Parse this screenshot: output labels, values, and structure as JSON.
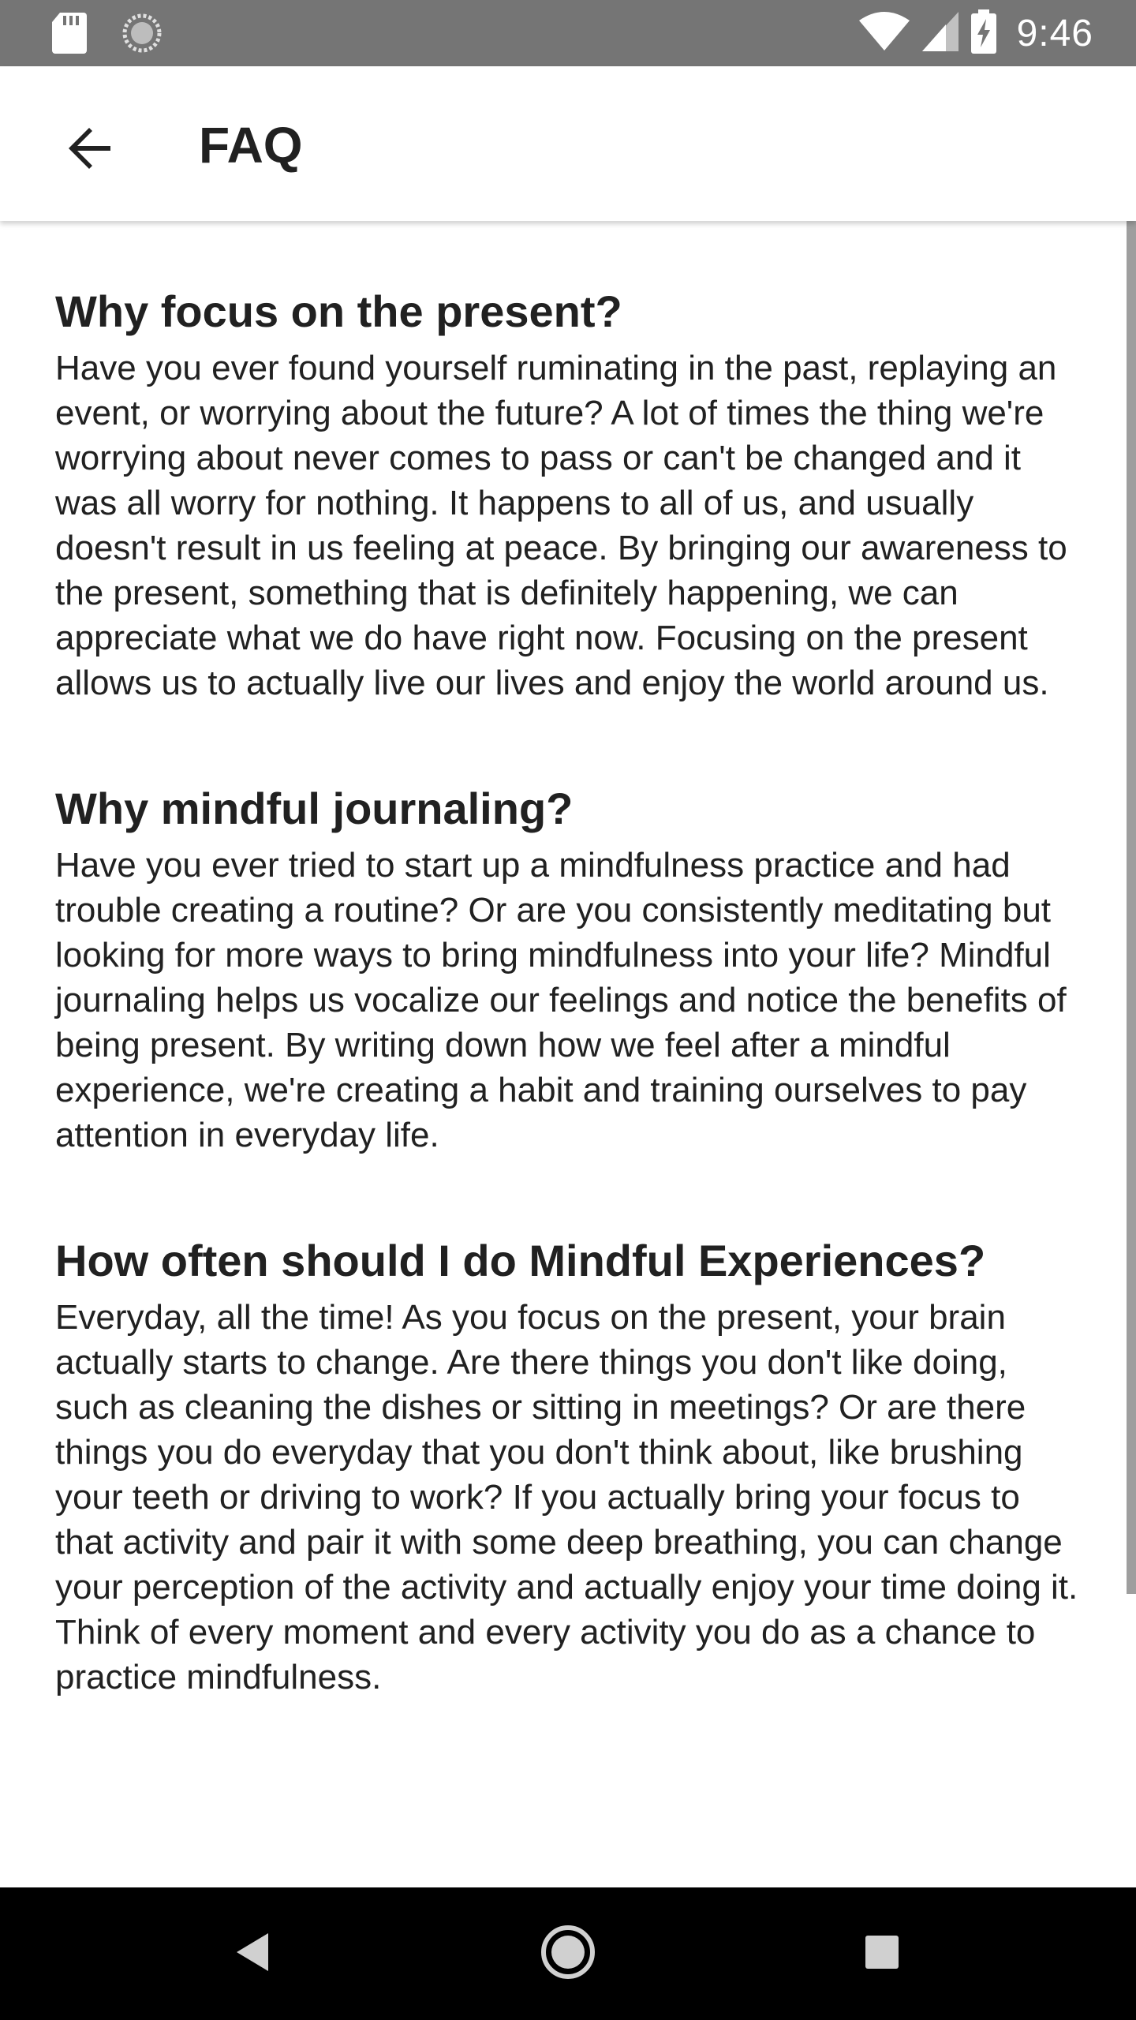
{
  "status_bar": {
    "time": "9:46",
    "icons": [
      "sd-card-icon",
      "sync-icon",
      "wifi-icon",
      "signal-icon",
      "battery-charging-icon"
    ]
  },
  "app_bar": {
    "title": "FAQ",
    "back_icon": "arrow-back-icon"
  },
  "faq": [
    {
      "question": "Why focus on the present?",
      "answer": "Have you ever found yourself ruminating in the past, replaying an event, or worrying about the future? A lot of times the thing we're worrying about never comes to pass or can't be changed and it was all worry for nothing. It happens to all of us, and usually doesn't result in us feeling at peace. By bringing our awareness to the present, something that is definitely happening, we can appreciate what we do have right now. Focusing on the present allows us to actually live our lives and enjoy the world around us."
    },
    {
      "question": "Why mindful journaling?",
      "answer": "Have you ever tried to start up a mindfulness practice and had trouble creating a routine? Or are you consistently meditating but looking for more ways to bring mindfulness into your life? Mindful journaling helps us vocalize our feelings and notice the benefits of being present. By writing down how we feel after a mindful experience, we're creating a habit and training ourselves to pay attention in everyday life."
    },
    {
      "question": "How often should I do Mindful Experiences?",
      "answer": "Everyday, all the time! As you focus on the present, your brain actually starts to change. Are there things you don't like doing, such as cleaning the dishes or sitting in meetings? Or are there things you do everyday that you don't think about, like brushing your teeth or driving to work? If you actually bring your focus to that activity and pair it with some deep breathing, you can change your perception of the activity and actually enjoy your time doing it. Think of every moment and every activity you do as a chance to practice mindfulness."
    }
  ],
  "nav_bar": {
    "icons": [
      "nav-back-icon",
      "nav-home-icon",
      "nav-recents-icon"
    ]
  },
  "colors": {
    "status_bar": "#757575",
    "text": "#212121",
    "nav_bar": "#000000"
  }
}
